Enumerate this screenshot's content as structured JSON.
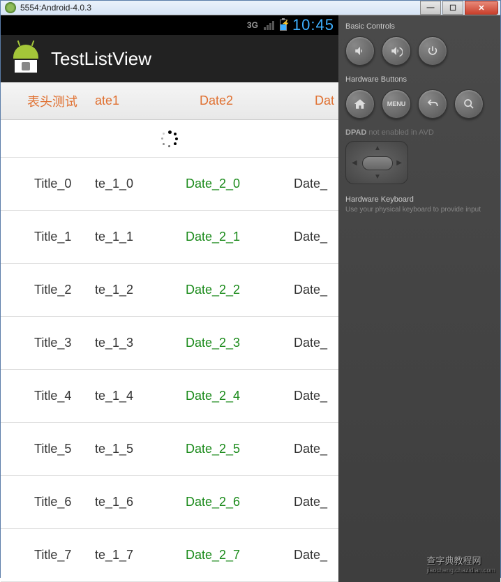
{
  "window": {
    "title": "5554:Android-4.0.3"
  },
  "statusbar": {
    "network": "3G",
    "time": "10:45"
  },
  "actionbar": {
    "title": "TestListView"
  },
  "table": {
    "headers": [
      "表头测试",
      "ate1",
      "Date2",
      "Dat"
    ],
    "rows": [
      {
        "c1": "Title_0",
        "c2": "te_1_0",
        "c3": "Date_2_0",
        "c4": "Date_"
      },
      {
        "c1": "Title_1",
        "c2": "te_1_1",
        "c3": "Date_2_1",
        "c4": "Date_"
      },
      {
        "c1": "Title_2",
        "c2": "te_1_2",
        "c3": "Date_2_2",
        "c4": "Date_"
      },
      {
        "c1": "Title_3",
        "c2": "te_1_3",
        "c3": "Date_2_3",
        "c4": "Date_"
      },
      {
        "c1": "Title_4",
        "c2": "te_1_4",
        "c3": "Date_2_4",
        "c4": "Date_"
      },
      {
        "c1": "Title_5",
        "c2": "te_1_5",
        "c3": "Date_2_5",
        "c4": "Date_"
      },
      {
        "c1": "Title_6",
        "c2": "te_1_6",
        "c3": "Date_2_6",
        "c4": "Date_"
      },
      {
        "c1": "Title_7",
        "c2": "te_1_7",
        "c3": "Date_2_7",
        "c4": "Date_"
      }
    ]
  },
  "sidepanel": {
    "basic_controls": "Basic Controls",
    "hardware_buttons": "Hardware Buttons",
    "menu_label": "MENU",
    "dpad_label": "DPAD",
    "dpad_note": "not enabled in AVD",
    "hw_kb_title": "Hardware Keyboard",
    "hw_kb_text": "Use your physical keyboard to provide input"
  },
  "watermark": {
    "cn": "查字典教程网",
    "url": "jiaocheng.chazidian.com"
  }
}
